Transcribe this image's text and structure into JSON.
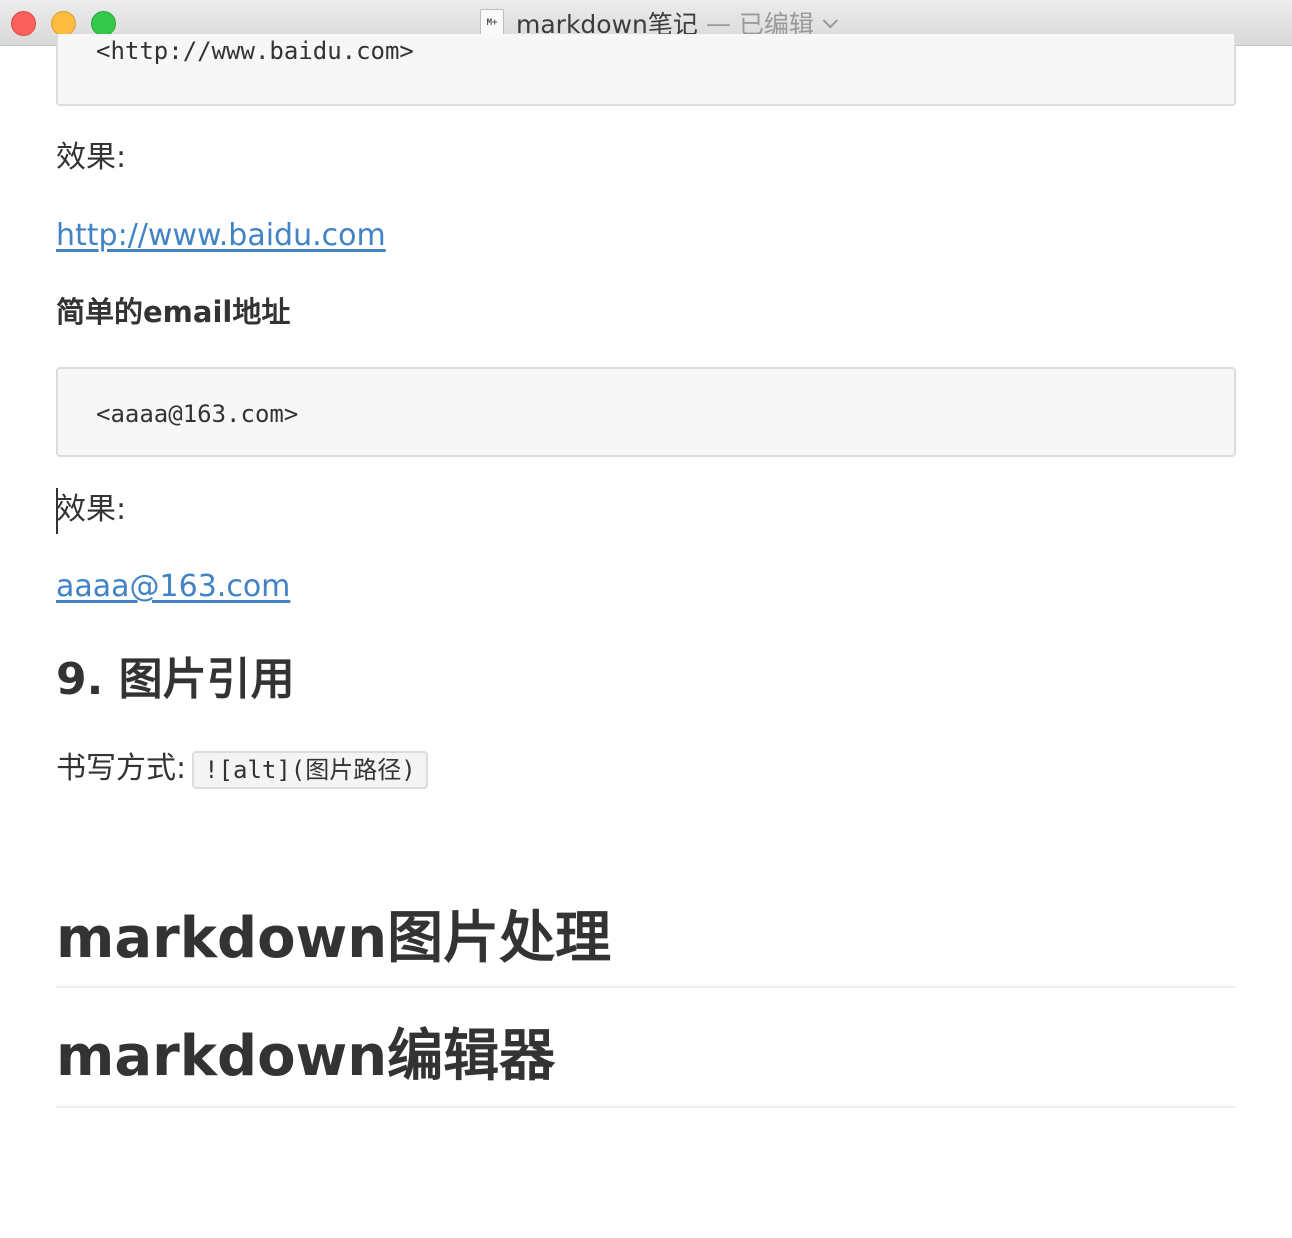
{
  "window": {
    "doc_icon": "M+",
    "title": "markdown笔记",
    "separator": "—",
    "status": "已编辑"
  },
  "content": {
    "code_block_1": "<http://www.baidu.com>",
    "effect_label_1": "效果:",
    "link_url": "http://www.baidu.com",
    "email_heading": "简单的email地址",
    "code_block_2": "<aaaa@163.com>",
    "effect_label_2": "效果:",
    "email_link": "aaaa@163.com",
    "section_heading": "9. 图片引用",
    "syntax_label": "书写方式:",
    "syntax_code": "![alt](图片路径)",
    "h1_image": "markdown图片处理",
    "h1_editor": "markdown编辑器"
  }
}
